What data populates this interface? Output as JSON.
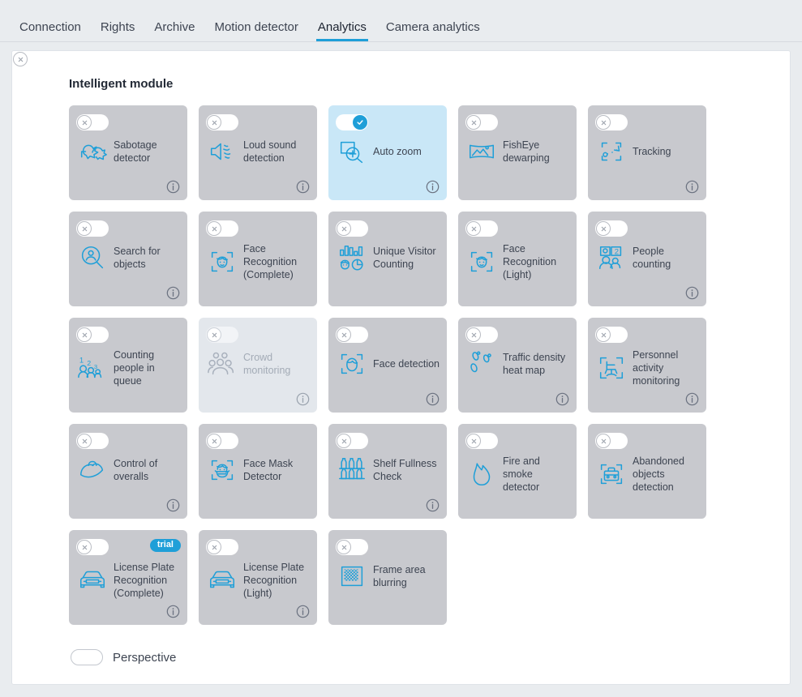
{
  "tabs": [
    {
      "label": "Connection",
      "active": false
    },
    {
      "label": "Rights",
      "active": false
    },
    {
      "label": "Archive",
      "active": false
    },
    {
      "label": "Motion detector",
      "active": false
    },
    {
      "label": "Analytics",
      "active": true
    },
    {
      "label": "Camera analytics",
      "active": false
    }
  ],
  "colors": {
    "accent": "#1f9fd8",
    "card": "#c8c9ce",
    "card_active": "#c9e7f7",
    "card_disabled": "#e3e7ec",
    "page_bg": "#e9ecef"
  },
  "section": {
    "title": "Intelligent module"
  },
  "modules": [
    {
      "label": "Sabotage detector",
      "icon": "sabotage-detector-icon",
      "enabled": false,
      "disabled": false,
      "info": true,
      "trial": null
    },
    {
      "label": "Loud sound detection",
      "icon": "loud-sound-detection-icon",
      "enabled": false,
      "disabled": false,
      "info": true,
      "trial": null
    },
    {
      "label": "Auto zoom",
      "icon": "auto-zoom-icon",
      "enabled": true,
      "disabled": false,
      "info": true,
      "trial": null
    },
    {
      "label": "FishEye dewarping",
      "icon": "fisheye-dewarping-icon",
      "enabled": false,
      "disabled": false,
      "info": false,
      "trial": null
    },
    {
      "label": "Tracking",
      "icon": "tracking-icon",
      "enabled": false,
      "disabled": false,
      "info": true,
      "trial": null
    },
    {
      "label": "Search for objects",
      "icon": "search-for-objects-icon",
      "enabled": false,
      "disabled": false,
      "info": true,
      "trial": null
    },
    {
      "label": "Face Recognition (Complete)",
      "icon": "face-recognition-complete-icon",
      "enabled": false,
      "disabled": false,
      "info": false,
      "trial": null
    },
    {
      "label": "Unique Visitor Counting",
      "icon": "unique-visitor-counting-icon",
      "enabled": false,
      "disabled": false,
      "info": false,
      "trial": null
    },
    {
      "label": "Face Recognition (Light)",
      "icon": "face-recognition-light-icon",
      "enabled": false,
      "disabled": false,
      "info": false,
      "trial": null
    },
    {
      "label": "People counting",
      "icon": "people-counting-icon",
      "enabled": false,
      "disabled": false,
      "info": true,
      "trial": null
    },
    {
      "label": "Counting people in queue",
      "icon": "counting-people-in-queue-icon",
      "enabled": false,
      "disabled": false,
      "info": false,
      "trial": null
    },
    {
      "label": "Crowd monitoring",
      "icon": "crowd-monitoring-icon",
      "enabled": false,
      "disabled": true,
      "info": true,
      "trial": null
    },
    {
      "label": "Face detection",
      "icon": "face-detection-icon",
      "enabled": false,
      "disabled": false,
      "info": true,
      "trial": null
    },
    {
      "label": "Traffic density heat map",
      "icon": "traffic-density-heat-map-icon",
      "enabled": false,
      "disabled": false,
      "info": true,
      "trial": null
    },
    {
      "label": "Personnel activity monitoring",
      "icon": "personnel-activity-monitoring-icon",
      "enabled": false,
      "disabled": false,
      "info": true,
      "trial": null
    },
    {
      "label": "Control of overalls",
      "icon": "control-of-overalls-icon",
      "enabled": false,
      "disabled": false,
      "info": true,
      "trial": null
    },
    {
      "label": "Face Mask Detector",
      "icon": "face-mask-detector-icon",
      "enabled": false,
      "disabled": false,
      "info": false,
      "trial": null
    },
    {
      "label": "Shelf Fullness Check",
      "icon": "shelf-fullness-check-icon",
      "enabled": false,
      "disabled": false,
      "info": true,
      "trial": null
    },
    {
      "label": "Fire and smoke detector",
      "icon": "fire-and-smoke-detector-icon",
      "enabled": false,
      "disabled": false,
      "info": false,
      "trial": null
    },
    {
      "label": "Abandoned objects detection",
      "icon": "abandoned-objects-detection-icon",
      "enabled": false,
      "disabled": false,
      "info": false,
      "trial": null
    },
    {
      "label": "License Plate Recognition (Complete)",
      "icon": "license-plate-recognition-complete-icon",
      "enabled": false,
      "disabled": false,
      "info": true,
      "trial": "trial"
    },
    {
      "label": "License Plate Recognition (Light)",
      "icon": "license-plate-recognition-light-icon",
      "enabled": false,
      "disabled": false,
      "info": true,
      "trial": null
    },
    {
      "label": "Frame area blurring",
      "icon": "frame-area-blurring-icon",
      "enabled": false,
      "disabled": false,
      "info": false,
      "trial": null
    }
  ],
  "perspective": {
    "label": "Perspective",
    "enabled": false
  }
}
